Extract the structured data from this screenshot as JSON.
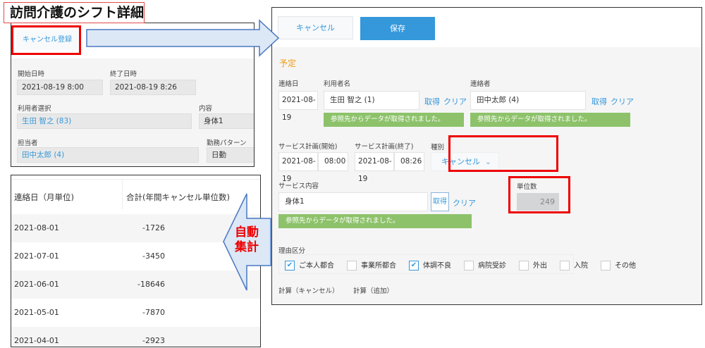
{
  "title": "訪問介護のシフト詳細",
  "left_panel": {
    "cancel_register_button": "キャンセル登録",
    "start_label": "開始日時",
    "start_value": "2021-08-19 8:00",
    "end_label": "終了日時",
    "end_value": "2021-08-19 8:26",
    "user_label": "利用者選択",
    "user_value": "生田 智之 (83)",
    "content_label": "内容",
    "content_value": "身体1",
    "staff_label": "担当者",
    "staff_value": "田中太郎 (4)",
    "pattern_label": "勤務パターン",
    "pattern_value": "日勤"
  },
  "right_panel": {
    "cancel_button": "キャンセル",
    "save_button": "保存",
    "section": "予定",
    "contact_date_label": "連絡日",
    "contact_date": "2021-08-19",
    "user_name_label": "利用者名",
    "user_name": "生田 智之 (1)",
    "contact_person_label": "連絡者",
    "contact_person": "田中太郎 (4)",
    "fetch": "取得",
    "clear": "クリア",
    "fetched_msg": "参照先からデータが取得されました。",
    "plan_start_label": "サービス計画(開始)",
    "plan_start_date": "2021-08-19",
    "plan_start_time": "08:00",
    "plan_end_label": "サービス計画(終了)",
    "plan_end_date": "2021-08-19",
    "plan_end_time": "08:26",
    "type_label": "種別",
    "type_value": "キャンセル",
    "service_label": "サービス内容",
    "service_value": "身体1",
    "units_label": "単位数",
    "units_value": "249",
    "reason_label": "理由区分",
    "reasons": [
      {
        "label": "ご本人都合",
        "checked": true
      },
      {
        "label": "事業所都合",
        "checked": false
      },
      {
        "label": "体調不良",
        "checked": true
      },
      {
        "label": "病院受診",
        "checked": false
      },
      {
        "label": "外出",
        "checked": false
      },
      {
        "label": "入院",
        "checked": false
      },
      {
        "label": "その他",
        "checked": false
      }
    ],
    "calc_cancel": "計算（キャンセル）",
    "calc_add": "計算（追加）"
  },
  "auto_label": {
    "line1": "自動",
    "line2": "集計"
  },
  "table": {
    "headers": [
      "連絡日（月単位)",
      "合計(年間キャンセル単位数)"
    ],
    "rows": [
      [
        "2021-08-01",
        "-1726"
      ],
      [
        "2021-07-01",
        "-3450"
      ],
      [
        "2021-06-01",
        "-18646"
      ],
      [
        "2021-05-01",
        "-7870"
      ],
      [
        "2021-04-01",
        "-2923"
      ]
    ]
  },
  "colors": {
    "accent": "#3498db",
    "success": "#8dc26a",
    "highlight": "#ee0000",
    "section": "#f39c12"
  }
}
